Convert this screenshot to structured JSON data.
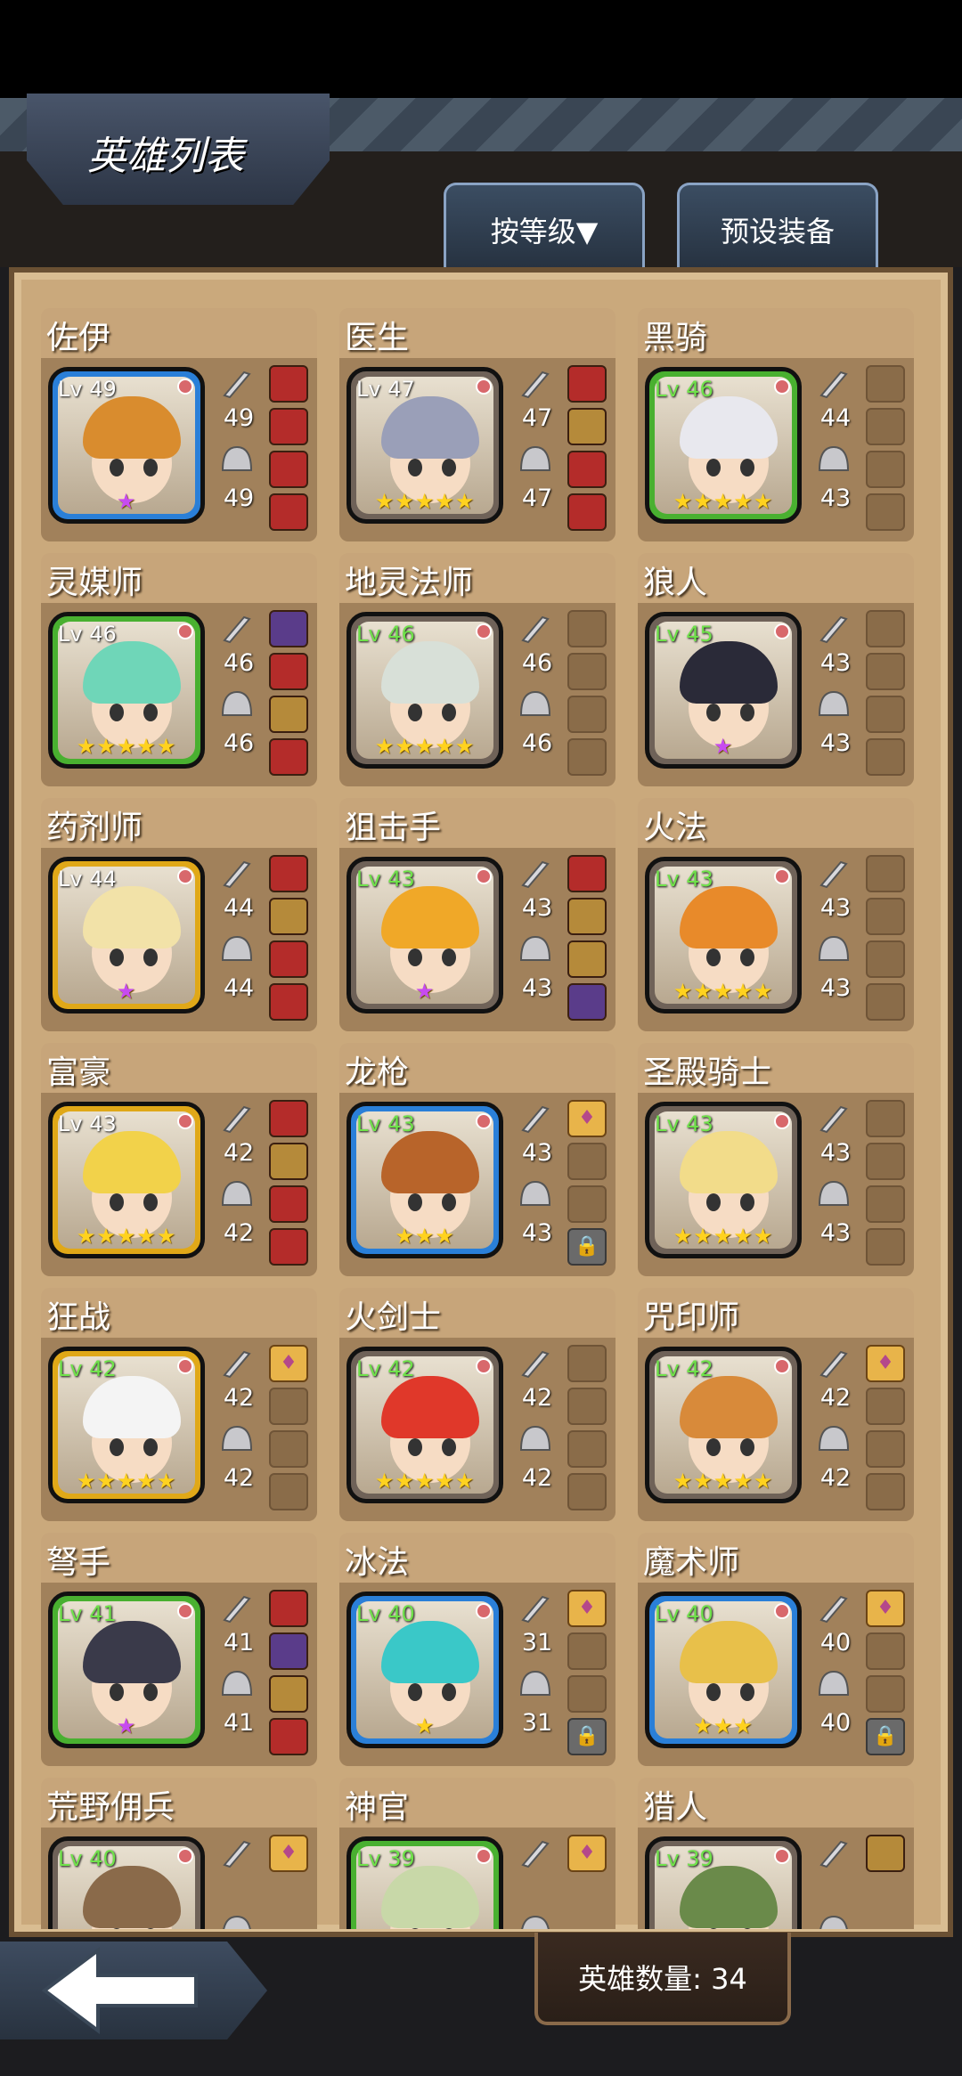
{
  "header": {
    "title": "英雄列表",
    "sort_label": "按等级▼",
    "preset_label": "预设装备"
  },
  "footer": {
    "hero_count": "英雄数量: 34"
  },
  "colors": {
    "green": "#49b030",
    "blue": "#2a7fd8",
    "gold": "#e0a818",
    "gray": "#6f6258"
  },
  "heroes": [
    {
      "name": "佐伊",
      "level": "Lv 49",
      "lv_green": false,
      "frame": "blue",
      "stars": "★",
      "star_type": "purple",
      "weapon": "49",
      "armor": "49",
      "slots": [
        "item",
        "item",
        "item",
        "item"
      ],
      "hair": "#d98c2e"
    },
    {
      "name": "医生",
      "level": "Lv 47",
      "lv_green": false,
      "frame": "gray",
      "stars": "★★★★★",
      "star_type": "gold",
      "weapon": "47",
      "armor": "47",
      "slots": [
        "item",
        "tan",
        "item",
        "item"
      ],
      "hair": "#9a9fb8"
    },
    {
      "name": "黑骑",
      "level": "Lv 46",
      "lv_green": true,
      "frame": "green",
      "stars": "★★★★★",
      "star_type": "gold",
      "weapon": "44",
      "armor": "43",
      "slots": [
        "empty",
        "empty",
        "empty",
        "empty"
      ],
      "hair": "#e8e8ee"
    },
    {
      "name": "灵媒师",
      "level": "Lv 46",
      "lv_green": false,
      "frame": "green",
      "stars": "★★★★★",
      "star_type": "gold",
      "weapon": "46",
      "armor": "46",
      "slots": [
        "blue",
        "item",
        "tan",
        "item"
      ],
      "hair": "#6fd6b8"
    },
    {
      "name": "地灵法师",
      "level": "Lv 46",
      "lv_green": true,
      "frame": "gray",
      "stars": "★★★★★",
      "star_type": "gold",
      "weapon": "46",
      "armor": "46",
      "slots": [
        "empty",
        "empty",
        "empty",
        "empty"
      ],
      "hair": "#d8e0d8"
    },
    {
      "name": "狼人",
      "level": "Lv 45",
      "lv_green": true,
      "frame": "gray",
      "stars": "★",
      "star_type": "purple",
      "weapon": "43",
      "armor": "43",
      "slots": [
        "empty",
        "empty",
        "empty",
        "empty"
      ],
      "hair": "#2a2a38"
    },
    {
      "name": "药剂师",
      "level": "Lv 44",
      "lv_green": false,
      "frame": "gold",
      "stars": "★",
      "star_type": "purple",
      "weapon": "44",
      "armor": "44",
      "slots": [
        "item",
        "tan",
        "item",
        "item"
      ],
      "hair": "#f2e2a8"
    },
    {
      "name": "狙击手",
      "level": "Lv 43",
      "lv_green": true,
      "frame": "gray",
      "stars": "★",
      "star_type": "purple",
      "weapon": "43",
      "armor": "43",
      "slots": [
        "item",
        "tan",
        "tan",
        "blue"
      ],
      "hair": "#f0a828"
    },
    {
      "name": "火法",
      "level": "Lv 43",
      "lv_green": true,
      "frame": "gray",
      "stars": "★★★★★",
      "star_type": "gold",
      "weapon": "43",
      "armor": "43",
      "slots": [
        "empty",
        "empty",
        "empty",
        "empty"
      ],
      "hair": "#e88a2a"
    },
    {
      "name": "富豪",
      "level": "Lv 43",
      "lv_green": false,
      "frame": "gold",
      "stars": "★★★★★",
      "star_type": "gold",
      "weapon": "42",
      "armor": "42",
      "slots": [
        "item",
        "tan",
        "item",
        "item"
      ],
      "hair": "#f2d24a"
    },
    {
      "name": "龙枪",
      "level": "Lv 43",
      "lv_green": true,
      "frame": "blue",
      "stars": "★★★",
      "star_type": "gold",
      "weapon": "43",
      "armor": "43",
      "slots": [
        "potion",
        "empty",
        "empty",
        "lock"
      ],
      "hair": "#b8642a"
    },
    {
      "name": "圣殿骑士",
      "level": "Lv 43",
      "lv_green": true,
      "frame": "gray",
      "stars": "★★★★★",
      "star_type": "gold",
      "weapon": "43",
      "armor": "43",
      "slots": [
        "empty",
        "empty",
        "empty",
        "empty"
      ],
      "hair": "#f2dc8a"
    },
    {
      "name": "狂战",
      "level": "Lv 42",
      "lv_green": true,
      "frame": "gold",
      "stars": "★★★★★",
      "star_type": "gold",
      "weapon": "42",
      "armor": "42",
      "slots": [
        "potion",
        "empty",
        "empty",
        "empty"
      ],
      "hair": "#f4f4f4"
    },
    {
      "name": "火剑士",
      "level": "Lv 42",
      "lv_green": true,
      "frame": "gray",
      "stars": "★★★★★",
      "star_type": "gold",
      "weapon": "42",
      "armor": "42",
      "slots": [
        "empty",
        "empty",
        "empty",
        "empty"
      ],
      "hair": "#e0382a"
    },
    {
      "name": "咒印师",
      "level": "Lv 42",
      "lv_green": true,
      "frame": "gray",
      "stars": "★★★★★",
      "star_type": "gold",
      "weapon": "42",
      "armor": "42",
      "slots": [
        "potion",
        "empty",
        "empty",
        "empty"
      ],
      "hair": "#d88a3a"
    },
    {
      "name": "弩手",
      "level": "Lv 41",
      "lv_green": true,
      "frame": "green",
      "stars": "★",
      "star_type": "purple",
      "weapon": "41",
      "armor": "41",
      "slots": [
        "item",
        "blue",
        "tan",
        "item"
      ],
      "hair": "#3a3a4a"
    },
    {
      "name": "冰法",
      "level": "Lv 40",
      "lv_green": true,
      "frame": "blue",
      "stars": "★",
      "star_type": "gold",
      "weapon": "31",
      "armor": "31",
      "slots": [
        "potion",
        "empty",
        "empty",
        "lock"
      ],
      "hair": "#3ac8c8"
    },
    {
      "name": "魔术师",
      "level": "Lv 40",
      "lv_green": true,
      "frame": "blue",
      "stars": "★★★",
      "star_type": "gold",
      "weapon": "40",
      "armor": "40",
      "slots": [
        "potion",
        "empty",
        "empty",
        "lock"
      ],
      "hair": "#e8c04a"
    },
    {
      "name": "荒野佣兵",
      "level": "Lv 40",
      "lv_green": true,
      "frame": "gray",
      "stars": "",
      "star_type": "gold",
      "weapon": "",
      "armor": "",
      "slots": [
        "potion"
      ],
      "hair": "#8a6a4a"
    },
    {
      "name": "神官",
      "level": "Lv 39",
      "lv_green": true,
      "frame": "green",
      "stars": "",
      "star_type": "gold",
      "weapon": "",
      "armor": "",
      "slots": [
        "potion"
      ],
      "hair": "#c8d8a8"
    },
    {
      "name": "猎人",
      "level": "Lv 39",
      "lv_green": true,
      "frame": "gray",
      "stars": "",
      "star_type": "gold",
      "weapon": "",
      "armor": "",
      "slots": [
        "tan"
      ],
      "hair": "#6a8a4a"
    }
  ]
}
